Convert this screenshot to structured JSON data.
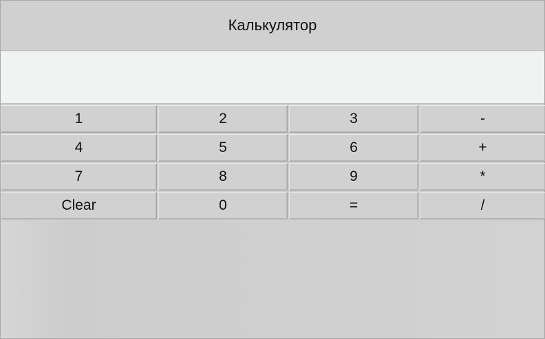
{
  "window": {
    "title": "Калькулятор"
  },
  "display": {
    "value": ""
  },
  "keypad": {
    "rows": [
      [
        {
          "label": "1",
          "name": "key-1"
        },
        {
          "label": "2",
          "name": "key-2"
        },
        {
          "label": "3",
          "name": "key-3"
        },
        {
          "label": "-",
          "name": "key-minus"
        }
      ],
      [
        {
          "label": "4",
          "name": "key-4"
        },
        {
          "label": "5",
          "name": "key-5"
        },
        {
          "label": "6",
          "name": "key-6"
        },
        {
          "label": "+",
          "name": "key-plus"
        }
      ],
      [
        {
          "label": "7",
          "name": "key-7"
        },
        {
          "label": "8",
          "name": "key-8"
        },
        {
          "label": "9",
          "name": "key-9"
        },
        {
          "label": "*",
          "name": "key-multiply"
        }
      ],
      [
        {
          "label": "Clear",
          "name": "key-clear"
        },
        {
          "label": "0",
          "name": "key-0"
        },
        {
          "label": "=",
          "name": "key-equals"
        },
        {
          "label": "/",
          "name": "key-divide"
        }
      ]
    ]
  },
  "colors": {
    "window_bg": "#cfcfcf",
    "display_bg": "#f1f2f2",
    "key_bg": "#d1d1d1",
    "text": "#111111"
  }
}
